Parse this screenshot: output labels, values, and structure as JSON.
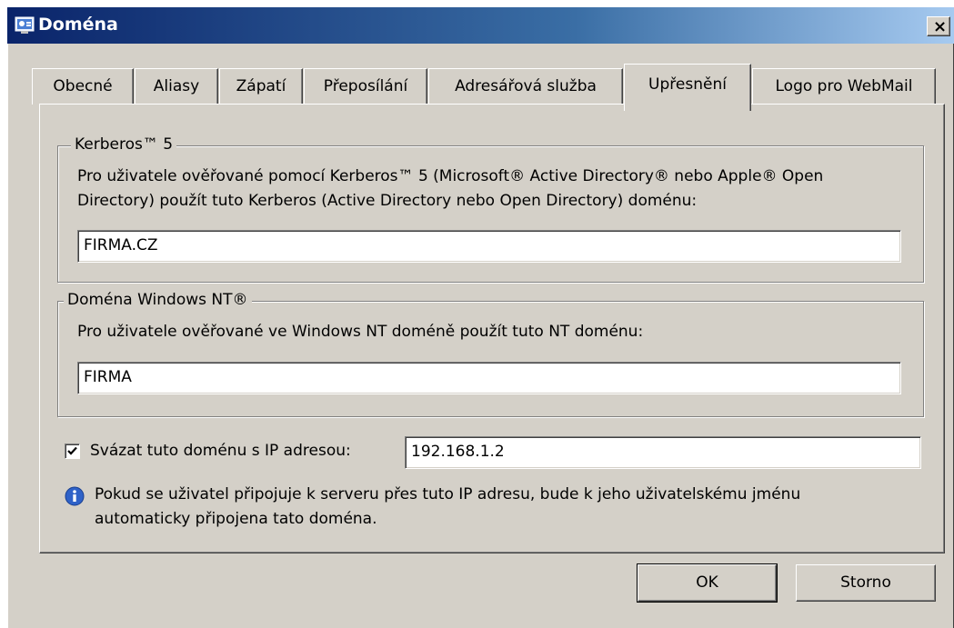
{
  "window": {
    "title": "Doména",
    "close_label": "×"
  },
  "tabs": [
    {
      "label": "Obecné"
    },
    {
      "label": "Aliasy"
    },
    {
      "label": "Zápatí"
    },
    {
      "label": "Přeposílání"
    },
    {
      "label": "Adresářová služba"
    },
    {
      "label": "Upřesnění"
    },
    {
      "label": "Logo pro WebMail"
    }
  ],
  "active_tab": "Upřesnění",
  "kerberos": {
    "legend": "Kerberos™ 5",
    "desc_line1": "Pro uživatele ověřované pomocí Kerberos™ 5 (Microsoft® Active Directory® nebo Apple® Open",
    "desc_line2": "Directory) použít tuto Kerberos (Active Directory nebo Open Directory) doménu:",
    "value": "FIRMA.CZ"
  },
  "nt": {
    "legend": "Doména Windows NT®",
    "desc": "Pro uživatele ověřované ve Windows NT doméně použít tuto NT doménu:",
    "value": "FIRMA"
  },
  "bind_ip": {
    "checked": true,
    "label": "Svázat tuto doménu s IP adresou:",
    "value": "192.168.1.2"
  },
  "info": {
    "line1": "Pokud se uživatel připojuje k serveru přes tuto IP adresu, bude k jeho uživatelskému jménu",
    "line2": "automaticky připojena tato doména."
  },
  "buttons": {
    "ok": "OK",
    "cancel": "Storno"
  },
  "colors": {
    "dialog_bg": "#d4d0c8",
    "title_bar": "#0a246a",
    "info_blue": "#2f62c8"
  }
}
